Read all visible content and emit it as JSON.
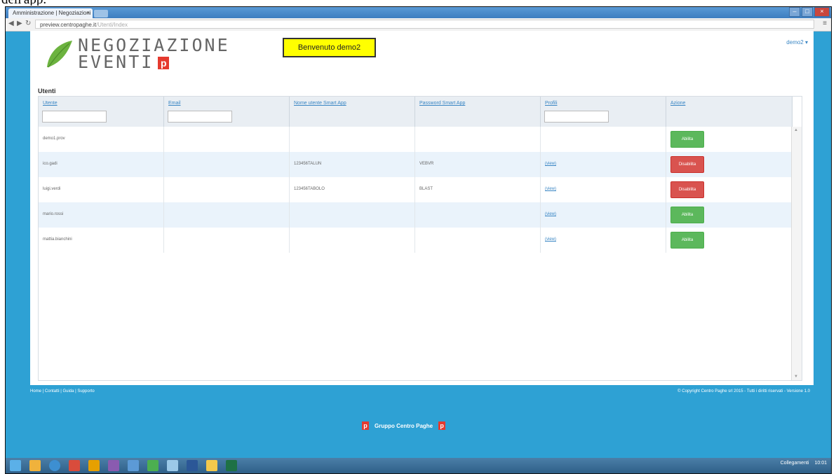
{
  "doc_text": "dell'app.",
  "browser": {
    "tab_title": "Amministrazione | Negoziazioni",
    "url": "preview.centropaghe.it",
    "url_path": "/Utenti/Index"
  },
  "header": {
    "logo_line1": "NEGOZIAZIONE",
    "logo_line2": "EVENTI",
    "logo_mark": "p",
    "welcome": "Benvenuto demo2",
    "user_menu": "demo2 ▾"
  },
  "section_title": "Utenti",
  "table": {
    "columns": [
      "Utente",
      "Email",
      "Nome utente Smart App",
      "Password Smart App",
      "Profili",
      "Azione"
    ],
    "rows": [
      {
        "utente": "demo1.prov",
        "email": "",
        "nome_smart": "",
        "password_smart": "",
        "profili": "",
        "azione": "Abilita",
        "azione_color": "green"
      },
      {
        "utente": "ico.gadi",
        "email": "",
        "nome_smart": "123456TALUN",
        "password_smart": "VEBVR",
        "profili": "(view)",
        "azione": "Disabilita",
        "azione_color": "red"
      },
      {
        "utente": "luigi.verdi",
        "email": "",
        "nome_smart": "123456TABOLO",
        "password_smart": "BLAST",
        "profili": "(view)",
        "azione": "Disabilita",
        "azione_color": "red"
      },
      {
        "utente": "mario.rossi",
        "email": "",
        "nome_smart": "",
        "password_smart": "",
        "profili": "(view)",
        "azione": "Abilita",
        "azione_color": "green"
      },
      {
        "utente": "mattia.bianchini",
        "email": "",
        "nome_smart": "",
        "password_smart": "",
        "profili": "(view)",
        "azione": "Abilita",
        "azione_color": "green"
      }
    ]
  },
  "footer": {
    "links": "Home | Contatti | Guida | Supporto",
    "copyright": "© Copyright Centro Paghe srl 2015 - Tutti i diritti riservati - Versione 1.0",
    "brand": "Gruppo Centro Paghe"
  },
  "taskbar": {
    "tray_text": "Collegamenti",
    "clock": "10:01"
  },
  "colors": {
    "background": "#2ea1d4",
    "enable": "#5cb85c",
    "disable": "#d9534f",
    "welcome_bg": "#ffff00",
    "link": "#3a86c4"
  }
}
